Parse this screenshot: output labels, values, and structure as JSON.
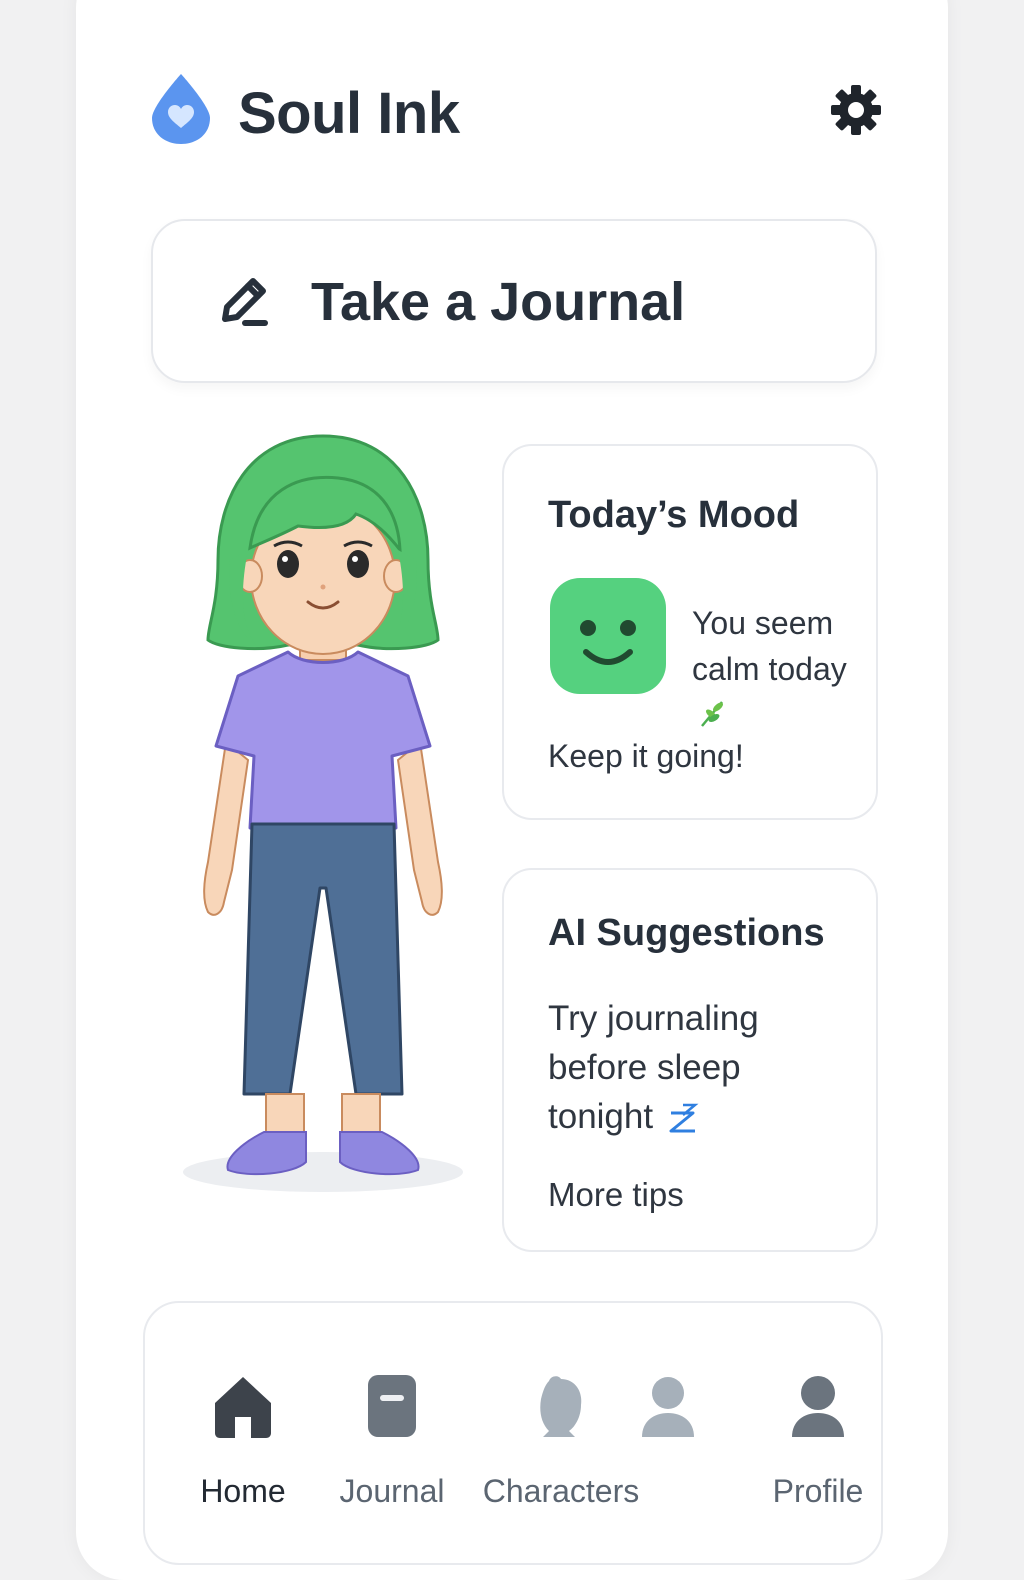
{
  "app": {
    "title": "Soul Ink"
  },
  "journal_button": {
    "label": "Take a Journal"
  },
  "mood_card": {
    "title": "Today’s Mood",
    "message": "You seem calm today",
    "cta": "Keep it going!"
  },
  "ai_card": {
    "title": "AI Suggestions",
    "text": "Try journaling before sleep tonight",
    "more": "More tips"
  },
  "nav": {
    "items": [
      {
        "label": "Home",
        "icon": "home-icon",
        "active": true
      },
      {
        "label": "Journal",
        "icon": "journal-icon",
        "active": false
      },
      {
        "label": "Characters",
        "icon": "characters-icon",
        "active": false
      },
      {
        "label": "",
        "icon": "person-icon",
        "active": false
      },
      {
        "label": "Profile",
        "icon": "profile-icon",
        "active": false
      }
    ]
  },
  "colors": {
    "brand_blue": "#5b95ef",
    "mood_green": "#55d17f",
    "hair_green": "#55c46f",
    "shirt_purple": "#a195ea",
    "pants_blue": "#4f6f96"
  }
}
